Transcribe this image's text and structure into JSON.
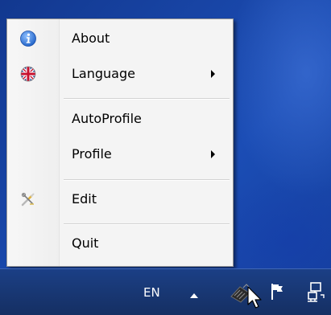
{
  "menu": {
    "items": [
      {
        "label": "About",
        "icon": "info-icon"
      },
      {
        "label": "Language",
        "icon": "uk-flag-icon",
        "submenu": true
      },
      {
        "label": "AutoProfile"
      },
      {
        "label": "Profile",
        "submenu": true
      },
      {
        "label": "Edit",
        "icon": "edit-tools-icon"
      },
      {
        "label": "Quit"
      }
    ]
  },
  "taskbar": {
    "language_indicator": "EN",
    "tray_icons": [
      "show-hidden-icons-arrow",
      "keyboard-app-icon",
      "action-center-flag-icon",
      "network-icon"
    ]
  },
  "colors": {
    "desktop": "#1a49ad",
    "menu_bg": "#f4f4f4",
    "taskbar": "#193977"
  }
}
